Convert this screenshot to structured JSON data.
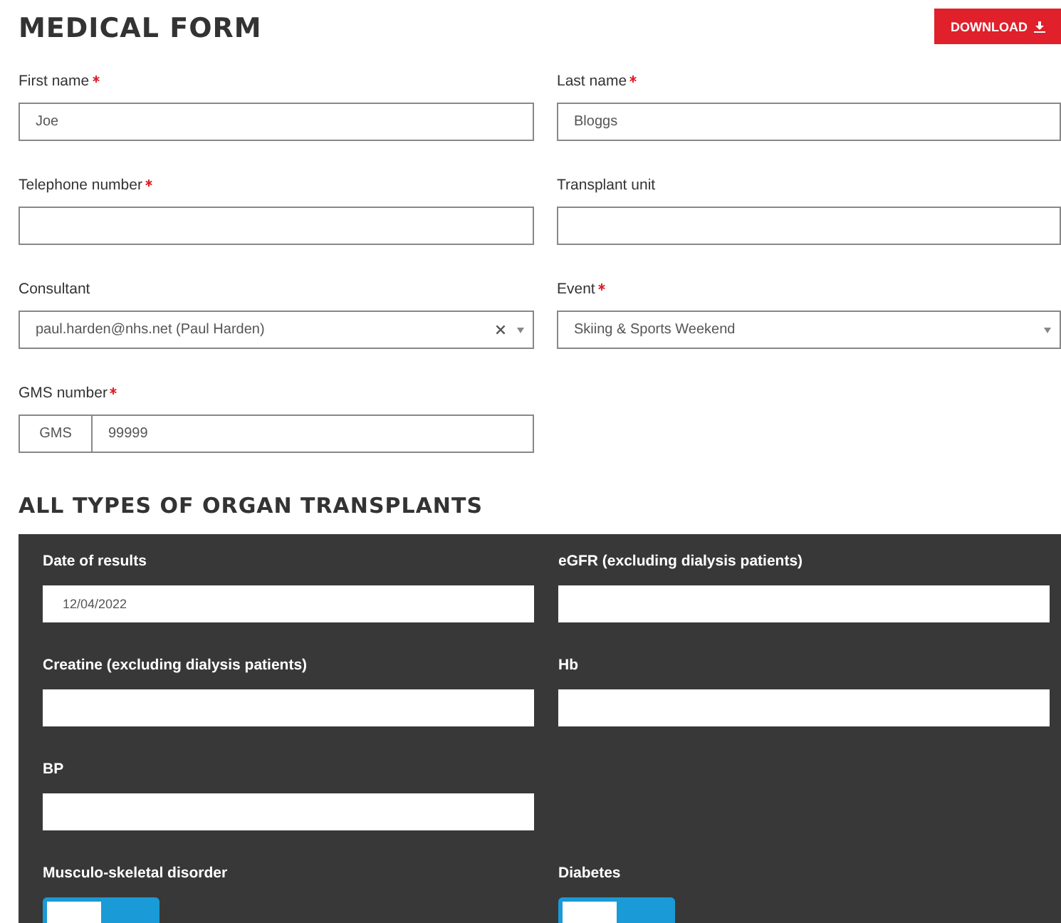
{
  "title": "MEDICAL FORM",
  "download_button": {
    "label": "DOWNLOAD"
  },
  "fields": [
    {
      "kind": "text",
      "label": "First name",
      "required": true,
      "value": "Joe"
    },
    {
      "kind": "text",
      "label": "Last name",
      "required": true,
      "value": "Bloggs"
    },
    {
      "kind": "text",
      "label": "Telephone number",
      "required": true
    },
    {
      "kind": "text",
      "label": "Transplant unit",
      "required": false
    },
    {
      "kind": "select",
      "label": "Consultant",
      "required": false,
      "value": "paul.harden@nhs.net (Paul Harden)",
      "clearable": true
    },
    {
      "kind": "select",
      "label": "Event",
      "required": true,
      "value": "Skiing & Sports Weekend",
      "clearable": false
    },
    {
      "kind": "prefixed",
      "label": "GMS number",
      "required": true,
      "prefix": "GMS",
      "value": "99999"
    }
  ],
  "section": {
    "title": "ALL TYPES OF ORGAN TRANSPLANTS",
    "fields": [
      {
        "kind": "text",
        "label": "Date of results",
        "value": "12/04/2022"
      },
      {
        "kind": "text",
        "label": "eGFR (excluding dialysis patients)"
      },
      {
        "kind": "text",
        "label": "Creatine (excluding dialysis patients)"
      },
      {
        "kind": "text",
        "label": "Hb"
      },
      {
        "kind": "text",
        "label": "BP"
      },
      {
        "kind": "empty"
      },
      {
        "kind": "toggle",
        "label": "Musculo-skeletal disorder",
        "on": false
      },
      {
        "kind": "toggle",
        "label": "Diabetes",
        "on": false
      }
    ]
  }
}
